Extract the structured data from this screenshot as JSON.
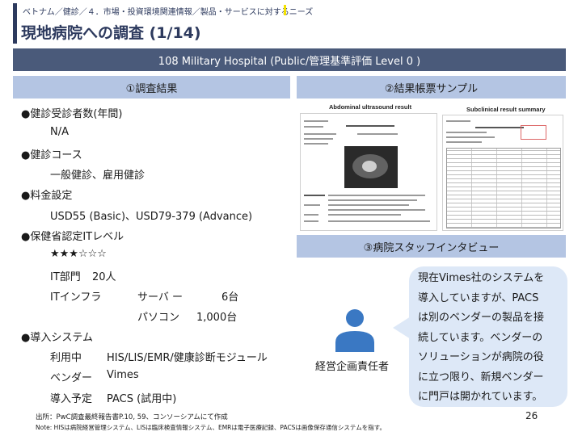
{
  "header": {
    "breadcrumb": "ベトナム／健診／４．市場・投資環境関連情報／製品・サービスに対するニーズ",
    "title": "現地病院への調査 (1/14)"
  },
  "hospital_banner": "108 Military Hospital (Public/管理基準評価 Level 0 )",
  "left_section": {
    "heading": "①調査結果",
    "items": [
      {
        "bullet": "●健診受診者数(年間)",
        "lines": [
          "N/A"
        ]
      },
      {
        "bullet": "●健診コース",
        "lines": [
          "一般健診、雇用健診"
        ]
      },
      {
        "bullet": "●料金設定",
        "lines": [
          "USD55 (Basic)、USD79-379 (Advance)"
        ]
      },
      {
        "bullet": "●保健省認定ITレベル",
        "lines": [
          "★★★☆☆☆"
        ]
      }
    ],
    "it_dept": {
      "label": "IT部門",
      "value": "20人"
    },
    "it_infra": {
      "label": "ITインフラ",
      "server_label": "サーバ ー",
      "server_value": "6台",
      "pc_label": "パソコン",
      "pc_value": "1,000台"
    },
    "system": {
      "bullet": "●導入システム",
      "in_use_label": "利用中",
      "in_use_value": "HIS/LIS/EMR/健康診断モジュール",
      "vendor_label": "ベンダー",
      "vendor_value": "Vimes",
      "planned_label": "導入予定",
      "planned_value": "PACS (試用中)"
    }
  },
  "sample_section": {
    "heading": "②結果帳票サンプル",
    "doc1_title": "Abdominal ultrasound result",
    "doc2_title": "Subclinical result summary"
  },
  "interview_section": {
    "heading": "③病院スタッフインタビュー",
    "role": "経営企画責任者",
    "quote_lines": [
      "現在Vimes社のシステムを",
      "導入していますが、PACS",
      "は別のベンダーの製品を接",
      "続しています。ベンダーの",
      "ソリューションが病院の役",
      "に立つ限り、新規ベンダー",
      "に門戸は開かれています。"
    ]
  },
  "footer": {
    "source": "出所：PwC調査最終報告書P.10, 59、コンソーシアムにて作成",
    "note": "Note: HISは病院経営管理システム、LISは臨床検査情報システム、EMRは電子医療記録、PACSは画像保存通信システムを指す。",
    "page_number": "26"
  },
  "colors": {
    "navy": "#2d3a5e",
    "banner": "#4a5a7a",
    "section_head": "#b4c5e3",
    "bubble": "#dde8f7",
    "icon": "#3a78c3",
    "highlight": "#f4e200"
  },
  "icons": [
    "person-icon"
  ]
}
